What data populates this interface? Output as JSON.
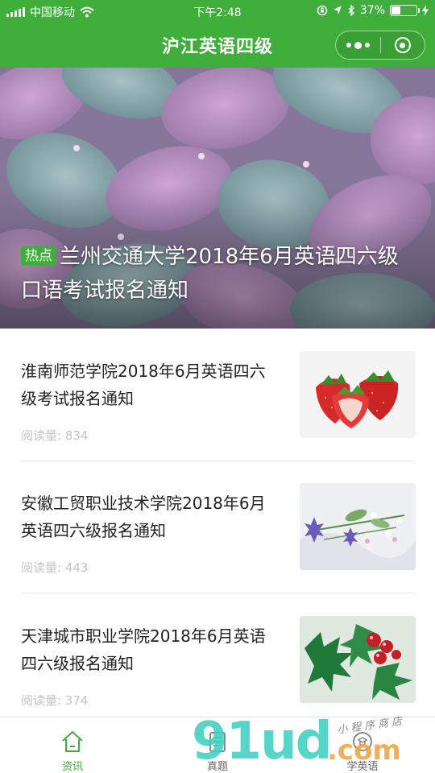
{
  "status_bar": {
    "carrier": "中国移动",
    "time": "下午2:48",
    "battery_percent": "37%",
    "battery_level": 0.37,
    "icons": [
      "signal-icon",
      "wifi-icon",
      "lock-rotation-icon",
      "location-icon",
      "bluetooth-icon",
      "battery-icon",
      "charging-icon"
    ]
  },
  "navbar": {
    "title": "沪江英语四级",
    "more_icon": "more-dots-icon",
    "close_icon": "close-target-icon"
  },
  "hero": {
    "tag": "热点",
    "title": "兰州交通大学2018年6月英语四六级口语考试报名通知"
  },
  "articles": [
    {
      "title": "淮南师范学院2018年6月英语四六级考试报名通知",
      "views": "阅读量: 834",
      "thumb": "strawberry-image"
    },
    {
      "title": "安徽工贸职业技术学院2018年6月英语四六级报名通知",
      "views": "阅读量: 443",
      "thumb": "flowers-image"
    },
    {
      "title": "天津城市职业学院2018年6月英语四六级报名通知",
      "views": "阅读量: 374",
      "thumb": "holly-image"
    }
  ],
  "tabbar": {
    "tabs": [
      {
        "label": "资讯",
        "icon": "home-icon",
        "active": true
      },
      {
        "label": "真题",
        "icon": "book-icon",
        "active": false
      },
      {
        "label": "学英语",
        "icon": "learn-icon",
        "active": false
      }
    ]
  },
  "watermark": {
    "main": "91ud",
    "suffix": ".com",
    "small": "小程序商店"
  },
  "colors": {
    "brand_green": "#3fae3b",
    "views_gray": "#c4c4c4",
    "watermark_teal": "#39d0c0",
    "watermark_orange": "#f0a23a"
  }
}
